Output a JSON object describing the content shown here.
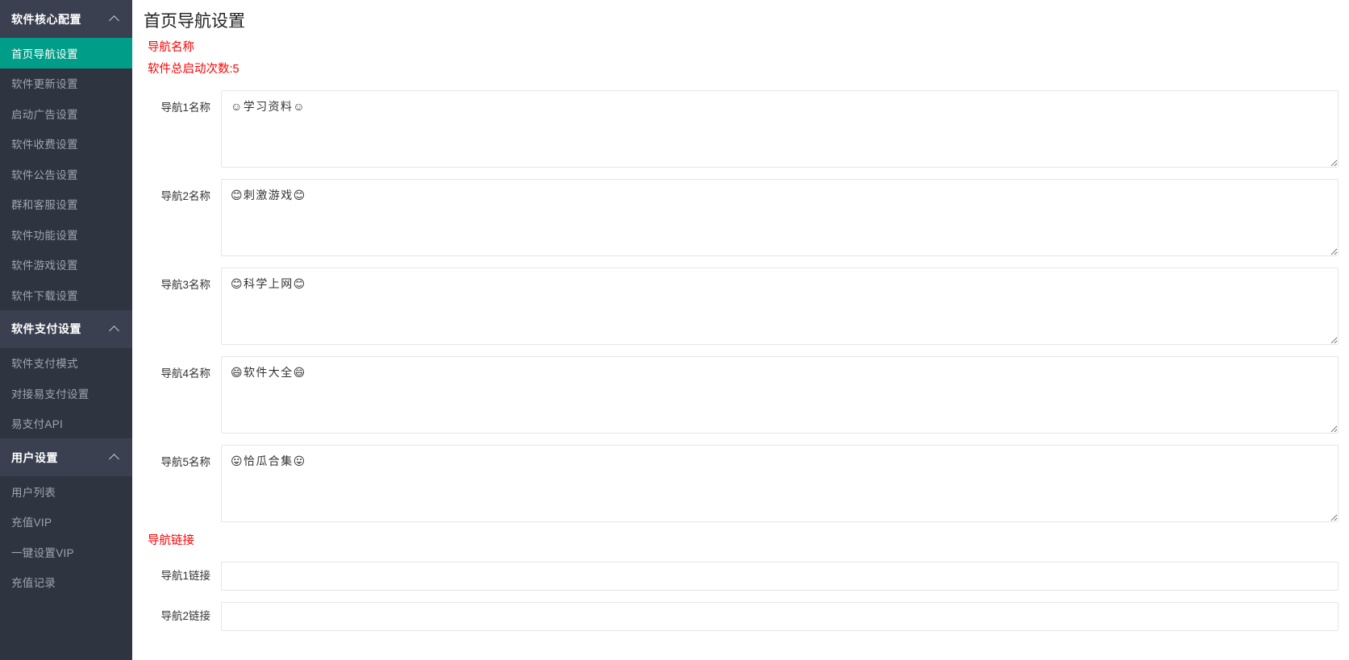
{
  "sidebar": {
    "groups": [
      {
        "title": "软件核心配置",
        "icon": "chevron-up-icon",
        "items": [
          {
            "label": "首页导航设置",
            "active": true
          },
          {
            "label": "软件更新设置",
            "active": false
          },
          {
            "label": "启动广告设置",
            "active": false
          },
          {
            "label": "软件收费设置",
            "active": false
          },
          {
            "label": "软件公告设置",
            "active": false
          },
          {
            "label": "群和客服设置",
            "active": false
          },
          {
            "label": "软件功能设置",
            "active": false
          },
          {
            "label": "软件游戏设置",
            "active": false
          },
          {
            "label": "软件下载设置",
            "active": false
          }
        ]
      },
      {
        "title": "软件支付设置",
        "icon": "chevron-up-icon",
        "items": [
          {
            "label": "软件支付模式",
            "active": false
          },
          {
            "label": "对接易支付设置",
            "active": false
          },
          {
            "label": "易支付API",
            "active": false
          }
        ]
      },
      {
        "title": "用户设置",
        "icon": "chevron-up-icon",
        "items": [
          {
            "label": "用户列表",
            "active": false
          },
          {
            "label": "充值VIP",
            "active": false
          },
          {
            "label": "一键设置VIP",
            "active": false
          },
          {
            "label": "充值记录",
            "active": false
          }
        ]
      }
    ]
  },
  "main": {
    "page_title": "首页导航设置",
    "name_section_label": "导航名称",
    "launch_count_note": "软件总启动次数:5",
    "link_section_label": "导航链接",
    "name_fields": [
      {
        "label": "导航1名称",
        "value": "☺学习资料☺",
        "placeholder": ""
      },
      {
        "label": "导航2名称",
        "value": "😊刺激游戏😊",
        "placeholder": ""
      },
      {
        "label": "导航3名称",
        "value": "😊科学上网😊",
        "placeholder": ""
      },
      {
        "label": "导航4名称",
        "value": "😄软件大全😄",
        "placeholder": ""
      },
      {
        "label": "导航5名称",
        "value": "😛恰瓜合集😛",
        "placeholder": ""
      }
    ],
    "link_fields": [
      {
        "label": "导航1链接",
        "value": "",
        "placeholder": ""
      },
      {
        "label": "导航2链接",
        "value": "",
        "placeholder": ""
      }
    ]
  },
  "colors": {
    "sidebar_bg": "#2f3441",
    "sidebar_group_bg": "#3a4050",
    "active_item": "#009e88",
    "section_label": "#ff0000",
    "body_text": "#333333"
  }
}
